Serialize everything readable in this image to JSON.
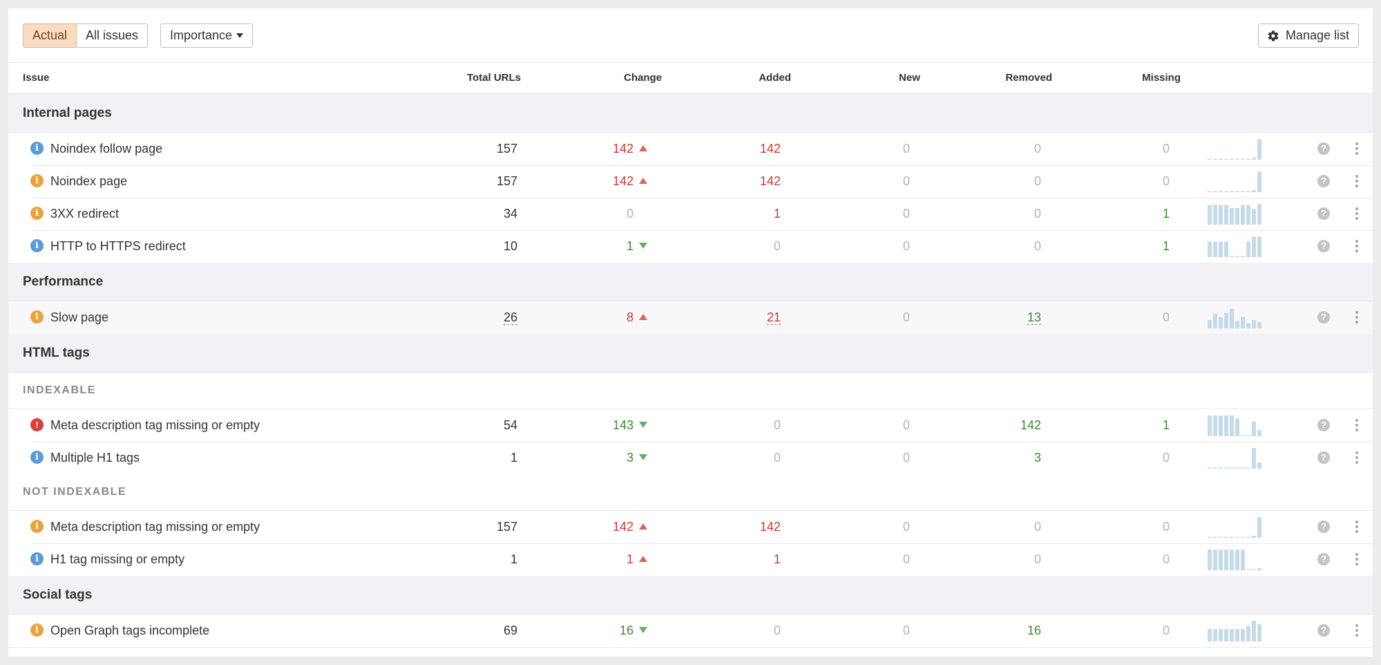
{
  "toolbar": {
    "filter_options": [
      "Actual",
      "All issues"
    ],
    "selected_filter": "Actual",
    "sort_label": "Importance",
    "manage_label": "Manage list"
  },
  "columns": [
    "Issue",
    "Total URLs",
    "Change",
    "Added",
    "New",
    "Removed",
    "Missing"
  ],
  "colors": {
    "negative": "#c83b33",
    "positive": "#3d8a2e",
    "neutral": "#b3b3b3",
    "info_icon": "#5b9bd5",
    "warning_icon": "#e8a33d",
    "error_icon": "#d9403a",
    "sparkline": "#c6dbea"
  },
  "groups": [
    {
      "name": "Internal pages",
      "rows": [
        {
          "icon": "info",
          "issue": "Noindex follow page",
          "total": "157",
          "change": "142",
          "change_dir": "up",
          "added": "142",
          "new": "0",
          "removed": "0",
          "missing": "0",
          "trend": [
            0.05,
            0.05,
            0.05,
            0.05,
            0.05,
            0.05,
            0.05,
            0.05,
            0.1,
            1
          ]
        },
        {
          "icon": "warning",
          "issue": "Noindex page",
          "total": "157",
          "change": "142",
          "change_dir": "up",
          "added": "142",
          "new": "0",
          "removed": "0",
          "missing": "0",
          "trend": [
            0.05,
            0.05,
            0.05,
            0.05,
            0.05,
            0.05,
            0.05,
            0.05,
            0.1,
            1
          ]
        },
        {
          "icon": "warning",
          "issue": "3XX redirect",
          "total": "34",
          "change": "0",
          "change_dir": "none",
          "added": "1",
          "new": "0",
          "removed": "0",
          "missing": "1",
          "trend": [
            0.95,
            0.95,
            0.95,
            0.95,
            0.8,
            0.8,
            0.95,
            0.95,
            0.75,
            1
          ]
        },
        {
          "icon": "info",
          "issue": "HTTP to HTTPS redirect",
          "total": "10",
          "change": "1",
          "change_dir": "down",
          "added": "0",
          "new": "0",
          "removed": "0",
          "missing": "1",
          "trend": [
            0.75,
            0.75,
            0.75,
            0.75,
            0.05,
            0.05,
            0.05,
            0.75,
            1,
            1
          ]
        }
      ]
    },
    {
      "name": "Performance",
      "rows": [
        {
          "icon": "warning",
          "issue": "Slow page",
          "total": "26",
          "total_dotted": true,
          "change": "8",
          "change_dir": "up",
          "added": "21",
          "added_dotted": true,
          "new": "0",
          "removed": "13",
          "removed_dotted": true,
          "missing": "0",
          "trend": [
            0.4,
            0.7,
            0.55,
            0.75,
            0.95,
            0.35,
            0.55,
            0.25,
            0.4,
            0.3
          ]
        }
      ]
    },
    {
      "name": "HTML tags",
      "subgroups": [
        {
          "name": "INDEXABLE",
          "rows": [
            {
              "icon": "error",
              "issue": "Meta description tag missing or empty",
              "total": "54",
              "change": "143",
              "change_dir": "down",
              "added": "0",
              "new": "0",
              "removed": "142",
              "missing": "1",
              "trend": [
                1,
                1,
                1,
                1,
                1,
                0.85,
                0.05,
                0.05,
                0.7,
                0.3
              ]
            },
            {
              "icon": "info",
              "issue": "Multiple H1 tags",
              "total": "1",
              "change": "3",
              "change_dir": "down",
              "added": "0",
              "new": "0",
              "removed": "3",
              "missing": "0",
              "trend": [
                0.05,
                0.05,
                0.05,
                0.05,
                0.05,
                0.05,
                0.05,
                0.05,
                1,
                0.3
              ]
            }
          ]
        },
        {
          "name": "NOT INDEXABLE",
          "rows": [
            {
              "icon": "warning",
              "issue": "Meta description tag missing or empty",
              "total": "157",
              "change": "142",
              "change_dir": "up",
              "added": "142",
              "new": "0",
              "removed": "0",
              "missing": "0",
              "trend": [
                0.05,
                0.05,
                0.05,
                0.05,
                0.05,
                0.05,
                0.05,
                0.05,
                0.1,
                1
              ]
            },
            {
              "icon": "info",
              "issue": "H1 tag missing or empty",
              "total": "1",
              "change": "1",
              "change_dir": "up",
              "added": "1",
              "new": "0",
              "removed": "0",
              "missing": "0",
              "trend": [
                1,
                1,
                1,
                1,
                1,
                1,
                1,
                0.05,
                0.05,
                0.1
              ]
            }
          ]
        }
      ]
    },
    {
      "name": "Social tags",
      "rows": [
        {
          "icon": "warning",
          "issue": "Open Graph tags incomplete",
          "total": "69",
          "change": "16",
          "change_dir": "down",
          "added": "0",
          "new": "0",
          "removed": "16",
          "missing": "0",
          "trend": [
            0.6,
            0.6,
            0.6,
            0.6,
            0.6,
            0.6,
            0.6,
            0.75,
            1,
            0.85
          ]
        }
      ]
    }
  ]
}
